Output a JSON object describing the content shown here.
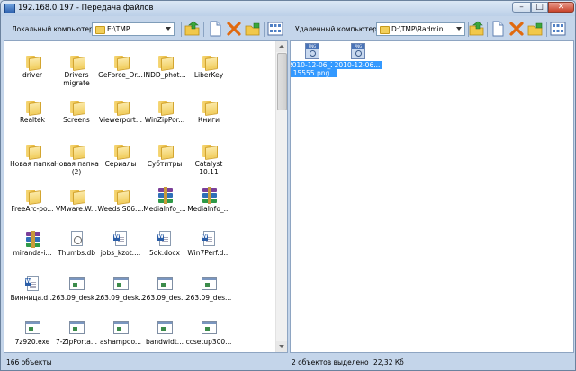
{
  "window": {
    "title": "192.168.0.197 - Передача файлов"
  },
  "local": {
    "label": "Локальный компьютер",
    "path": "E:\\TMP",
    "items": [
      {
        "name": "driver",
        "icon": "folder-icon"
      },
      {
        "name": "Drivers\nmigrate",
        "icon": "folder-icon"
      },
      {
        "name": "GeForce_Dr...",
        "icon": "folder-icon"
      },
      {
        "name": "INDD_phot...",
        "icon": "folder-icon"
      },
      {
        "name": "LiberKey",
        "icon": "folder-icon"
      },
      {
        "name": "Realtek",
        "icon": "folder-icon"
      },
      {
        "name": "Screens",
        "icon": "folder-icon"
      },
      {
        "name": "Viewerport...",
        "icon": "folder-icon"
      },
      {
        "name": "WinZipPor...",
        "icon": "folder-icon"
      },
      {
        "name": "Книги",
        "icon": "folder-icon"
      },
      {
        "name": "Новая папка",
        "icon": "folder-icon"
      },
      {
        "name": "Новая папка\n(2)",
        "icon": "folder-icon"
      },
      {
        "name": "Сериалы",
        "icon": "folder-icon"
      },
      {
        "name": "Субтитры",
        "icon": "folder-icon"
      },
      {
        "name": "Catalyst\n10.11",
        "icon": "folder-icon"
      },
      {
        "name": "FreeArc-po...",
        "icon": "folder-icon"
      },
      {
        "name": "VMware.W...",
        "icon": "folder-icon"
      },
      {
        "name": "Weeds.S06....",
        "icon": "folder-icon"
      },
      {
        "name": "MediaInfo_...",
        "icon": "rar-icon"
      },
      {
        "name": "MediaInfo_...",
        "icon": "rar-icon"
      },
      {
        "name": "miranda-i...",
        "icon": "rar-icon"
      },
      {
        "name": "Thumbs.db",
        "icon": "db-icon"
      },
      {
        "name": "jobs_kzot....",
        "icon": "word-doc-icon"
      },
      {
        "name": "5ok.docx",
        "icon": "word-doc-icon"
      },
      {
        "name": "Win7Perf.d...",
        "icon": "word-doc-icon"
      },
      {
        "name": "Винница.d...",
        "icon": "word-doc-icon"
      },
      {
        "name": "263.09_desk...",
        "icon": "exe-icon"
      },
      {
        "name": "263.09_desk...",
        "icon": "exe-icon"
      },
      {
        "name": "263.09_des...",
        "icon": "exe-icon"
      },
      {
        "name": "263.09_des...",
        "icon": "exe-icon"
      },
      {
        "name": "7z920.exe",
        "icon": "exe-icon"
      },
      {
        "name": "7-ZipPorta...",
        "icon": "exe-icon"
      },
      {
        "name": "ashampoo...",
        "icon": "exe-icon"
      },
      {
        "name": "bandwidt...",
        "icon": "exe-icon"
      },
      {
        "name": "ccsetup300...",
        "icon": "exe-icon"
      }
    ]
  },
  "remote": {
    "label": "Удаленный компьютер",
    "path": "D:\\TMP\\Radmin",
    "items": [
      {
        "name": "2010-12-06_2\n15555.png",
        "icon": "png-icon",
        "selected": true
      },
      {
        "name": "2010-12-06...",
        "icon": "png-icon",
        "selected": true
      }
    ]
  },
  "status": {
    "left_count": "166 объекты",
    "right_selected": "2 объектов выделено",
    "right_size": "22,32 Кб"
  }
}
